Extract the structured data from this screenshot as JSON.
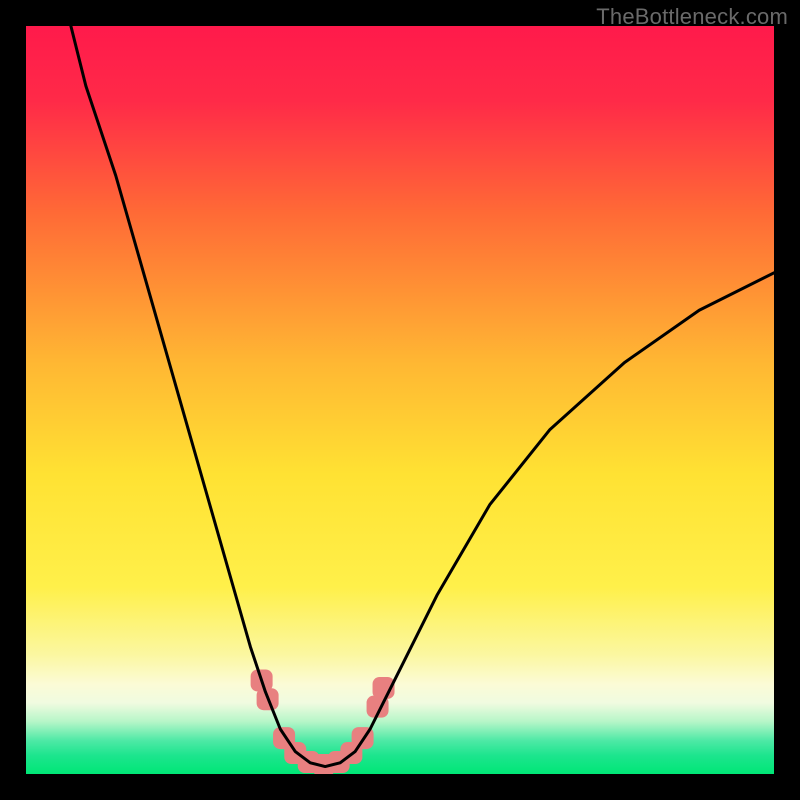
{
  "watermark": "TheBottleneck.com",
  "chart_data": {
    "type": "line",
    "title": "",
    "xlabel": "",
    "ylabel": "",
    "xlim": [
      0,
      100
    ],
    "ylim": [
      0,
      100
    ],
    "grid": false,
    "gradient_stops": [
      {
        "offset": 0.0,
        "color": "#ff1a4b"
      },
      {
        "offset": 0.1,
        "color": "#ff2a48"
      },
      {
        "offset": 0.25,
        "color": "#ff6a36"
      },
      {
        "offset": 0.45,
        "color": "#ffb733"
      },
      {
        "offset": 0.6,
        "color": "#ffe233"
      },
      {
        "offset": 0.75,
        "color": "#fff04a"
      },
      {
        "offset": 0.84,
        "color": "#fbf7a0"
      },
      {
        "offset": 0.88,
        "color": "#fbfbd6"
      },
      {
        "offset": 0.905,
        "color": "#f0fbe0"
      },
      {
        "offset": 0.93,
        "color": "#b6f6c8"
      },
      {
        "offset": 0.955,
        "color": "#4fe9a6"
      },
      {
        "offset": 0.975,
        "color": "#1de58e"
      },
      {
        "offset": 1.0,
        "color": "#00e676"
      }
    ],
    "series": [
      {
        "name": "bottleneck-curve",
        "color": "#000000",
        "stroke_width": 3,
        "points": [
          {
            "x": 6.0,
            "y": 100.0
          },
          {
            "x": 8.0,
            "y": 92.0
          },
          {
            "x": 12.0,
            "y": 80.0
          },
          {
            "x": 16.0,
            "y": 66.0
          },
          {
            "x": 20.0,
            "y": 52.0
          },
          {
            "x": 24.0,
            "y": 38.0
          },
          {
            "x": 28.0,
            "y": 24.0
          },
          {
            "x": 30.0,
            "y": 17.0
          },
          {
            "x": 32.0,
            "y": 11.0
          },
          {
            "x": 34.0,
            "y": 6.0
          },
          {
            "x": 36.0,
            "y": 3.0
          },
          {
            "x": 38.0,
            "y": 1.5
          },
          {
            "x": 40.0,
            "y": 1.0
          },
          {
            "x": 42.0,
            "y": 1.5
          },
          {
            "x": 44.0,
            "y": 3.0
          },
          {
            "x": 46.0,
            "y": 6.0
          },
          {
            "x": 50.0,
            "y": 14.0
          },
          {
            "x": 55.0,
            "y": 24.0
          },
          {
            "x": 62.0,
            "y": 36.0
          },
          {
            "x": 70.0,
            "y": 46.0
          },
          {
            "x": 80.0,
            "y": 55.0
          },
          {
            "x": 90.0,
            "y": 62.0
          },
          {
            "x": 100.0,
            "y": 67.0
          }
        ]
      }
    ],
    "markers": {
      "name": "trough-markers",
      "color": "#e88080",
      "shape": "rounded-square",
      "size": 22,
      "points": [
        {
          "x": 31.5,
          "y": 12.5
        },
        {
          "x": 32.3,
          "y": 10.0
        },
        {
          "x": 34.5,
          "y": 4.8
        },
        {
          "x": 36.0,
          "y": 2.8
        },
        {
          "x": 37.8,
          "y": 1.6
        },
        {
          "x": 39.8,
          "y": 1.2
        },
        {
          "x": 41.8,
          "y": 1.6
        },
        {
          "x": 43.5,
          "y": 2.8
        },
        {
          "x": 45.0,
          "y": 4.8
        },
        {
          "x": 47.0,
          "y": 9.0
        },
        {
          "x": 47.8,
          "y": 11.5
        }
      ]
    }
  }
}
